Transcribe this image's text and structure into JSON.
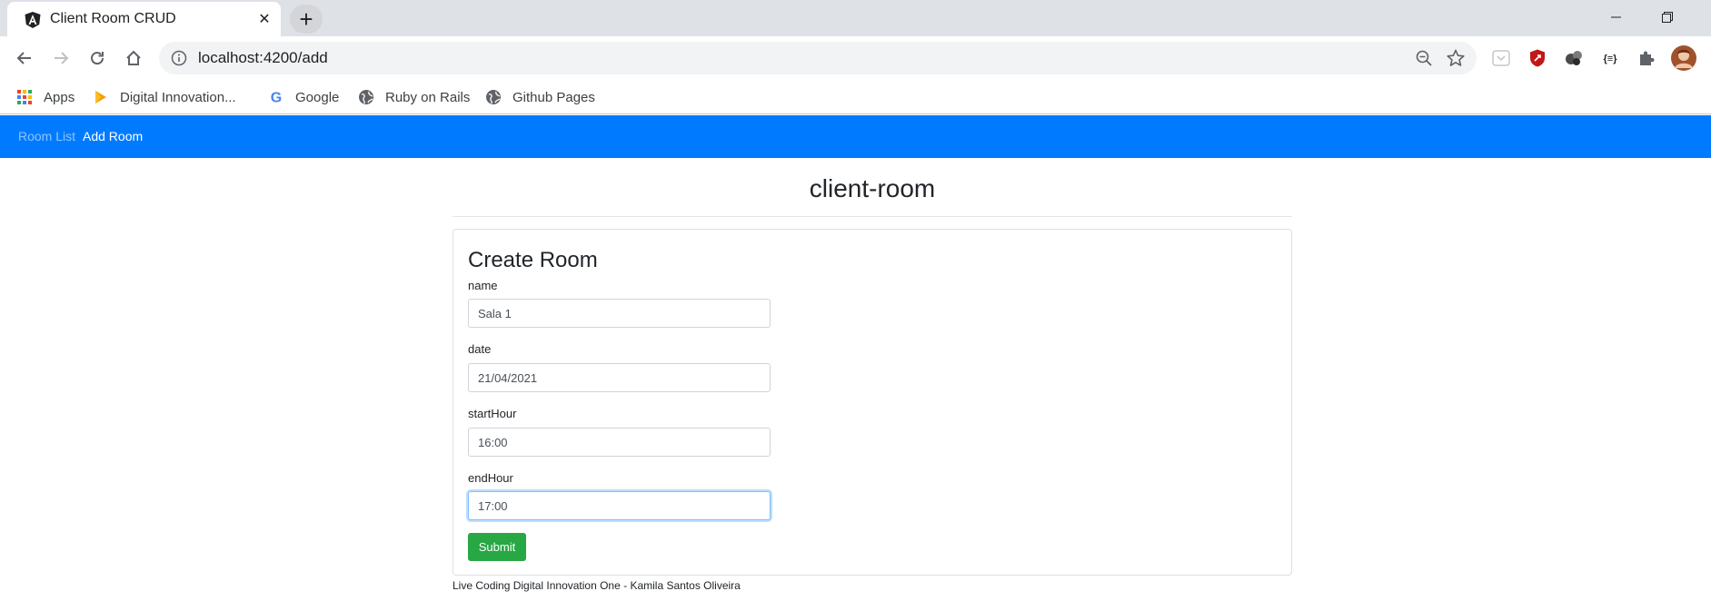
{
  "browser": {
    "tab_title": "Client Room CRUD",
    "tab_close": "✕",
    "new_tab": "+",
    "url": "localhost:4200/add",
    "bookmarks": [
      {
        "label": "Apps",
        "icon": "apps-grid-icon"
      },
      {
        "label": "Digital Innovation...",
        "icon": "dio-icon"
      },
      {
        "label": "Google",
        "icon": "google-icon"
      },
      {
        "label": "Ruby on Rails",
        "icon": "globe-icon"
      },
      {
        "label": "Github Pages",
        "icon": "globe-icon"
      }
    ],
    "colors": {
      "tabstrip": "#dee1e6",
      "omnibox": "#f1f3f4"
    }
  },
  "app": {
    "nav": {
      "room_list": "Room List",
      "add_room": "Add Room"
    },
    "title": "client-room",
    "form": {
      "heading": "Create Room",
      "fields": [
        {
          "label": "name",
          "value": "Sala 1"
        },
        {
          "label": "date",
          "value": "21/04/2021"
        },
        {
          "label": "startHour",
          "value": "16:00"
        },
        {
          "label": "endHour",
          "value": "17:00"
        }
      ],
      "submit_label": "Submit"
    },
    "footer": "Live Coding Digital Innovation One - Kamila Santos Oliveira",
    "colors": {
      "navbar": "#007bff",
      "submit": "#28a745",
      "focus_border": "#80bdff"
    }
  }
}
